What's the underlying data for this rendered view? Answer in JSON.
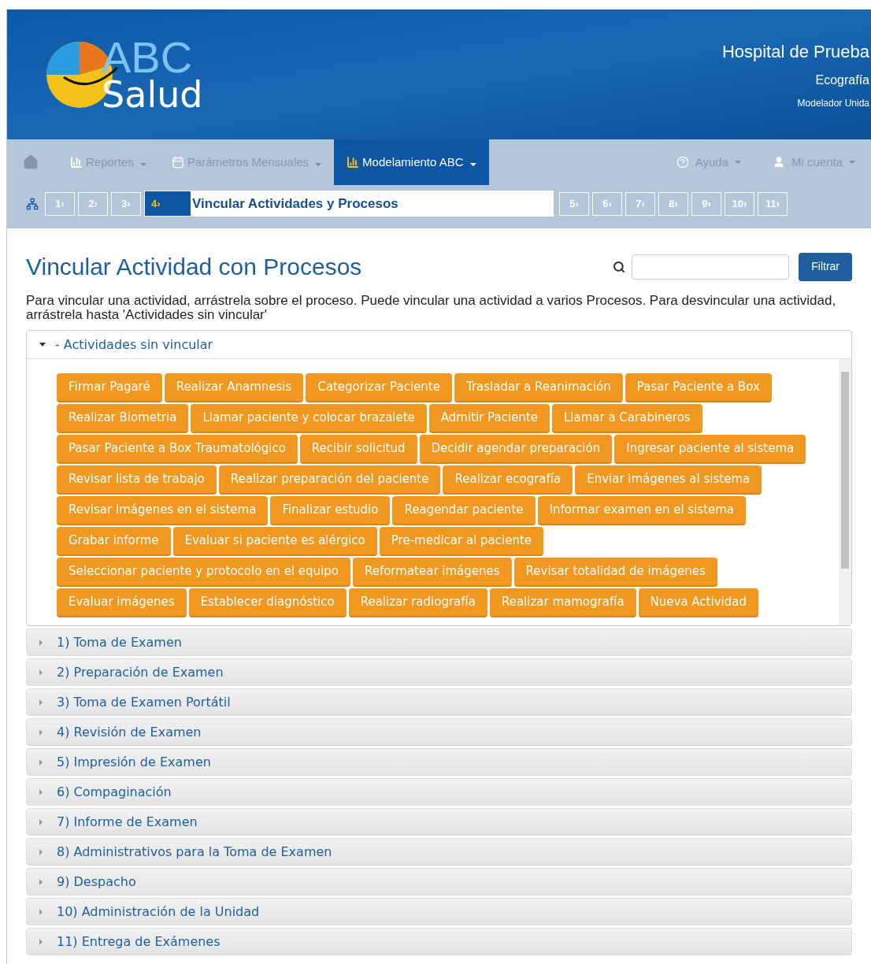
{
  "header": {
    "logo_top": "ABC",
    "logo_bottom": "Salud",
    "hospital": "Hospital de Prueba",
    "unit": "Ecografía",
    "subtitle": "Modelador Unida"
  },
  "nav": {
    "items": [
      {
        "kind": "home",
        "selected": false
      },
      {
        "kind": "chart",
        "label": "Reportes",
        "selected": false
      },
      {
        "kind": "calendar",
        "label": "Parámetros Mensuales",
        "selected": false
      },
      {
        "kind": "chart",
        "label": "Modelamiento ABC",
        "selected": true
      }
    ],
    "right_items": [
      {
        "kind": "help",
        "label": "Ayuda"
      },
      {
        "kind": "user",
        "label": "Mi cuenta"
      }
    ]
  },
  "steps": [
    {
      "label": "1›",
      "selected": false
    },
    {
      "label": "2›",
      "selected": false
    },
    {
      "label": "3›",
      "selected": false
    },
    {
      "label": "4›",
      "selected": true,
      "title": "Vincular Actividades y Procesos"
    },
    {
      "label": "5›",
      "selected": false
    },
    {
      "label": "6›",
      "selected": false
    },
    {
      "label": "7›",
      "selected": false
    },
    {
      "label": "8›",
      "selected": false
    },
    {
      "label": "9›",
      "selected": false
    },
    {
      "label": "10›",
      "selected": false
    },
    {
      "label": "11›",
      "selected": false
    }
  ],
  "page_title": "Vincular Actividad con Procesos",
  "filter_button": "Filtrar",
  "instructions": "Para vincular una actividad, arrástrela sobre el proceso. Puede vincular una actividad a varios Procesos. Para desvincular una actividad, arrástrela hasta 'Actividades sin vincular'",
  "unlinked_panel": {
    "title": "- Actividades sin vincular",
    "expanded": true,
    "activities": [
      "Firmar Pagaré",
      "Realizar Anamnesis",
      "Categorizar Paciente",
      "Trasladar a Reanimación",
      "Pasar Paciente a Box",
      "Realizar Biometria",
      "Llamar paciente y colocar brazalete",
      "Admitir Paciente",
      "Llamar a Carabineros",
      "Pasar Paciente a Box Traumatológico",
      "Recibir solicitud",
      "Decidir agendar preparación",
      "Ingresar paciente al sistema",
      "Revisar lista de trabajo",
      "Realizar preparación del paciente",
      "Realizar ecografía",
      "Enviar imágenes al sistema",
      "Revisar imágenes en el sistema",
      "Finalizar estudio",
      "Reagendar paciente",
      "Informar examen en el sistema",
      "Grabar informe",
      "Evaluar si paciente es alérgico",
      "Pre-medicar al paciente",
      "Seleccionar paciente y protocolo en el equipo",
      "Reformatear imágenes",
      "Revisar totalidad de imágenes",
      "Evaluar imágenes",
      "Establecer diagnóstico",
      "Realizar radiografía",
      "Realizar mamografía",
      "Nueva Actividad"
    ]
  },
  "processes": [
    {
      "title": "1) Toma de Examen",
      "expanded": false
    },
    {
      "title": "2) Preparación de Examen",
      "expanded": false
    },
    {
      "title": "3) Toma de Examen Portátil",
      "expanded": false
    },
    {
      "title": "4) Revisión de Examen",
      "expanded": false
    },
    {
      "title": "5) Impresión de Examen",
      "expanded": false
    },
    {
      "title": "6) Compaginación",
      "expanded": false
    },
    {
      "title": "7) Informe de Examen",
      "expanded": false
    },
    {
      "title": "8) Administrativos para la Toma de Examen",
      "expanded": false
    },
    {
      "title": "9) Despacho",
      "expanded": false
    },
    {
      "title": "10) Administración de la Unidad",
      "expanded": false
    },
    {
      "title": "11) Entrega de Exámenes",
      "expanded": false
    }
  ]
}
